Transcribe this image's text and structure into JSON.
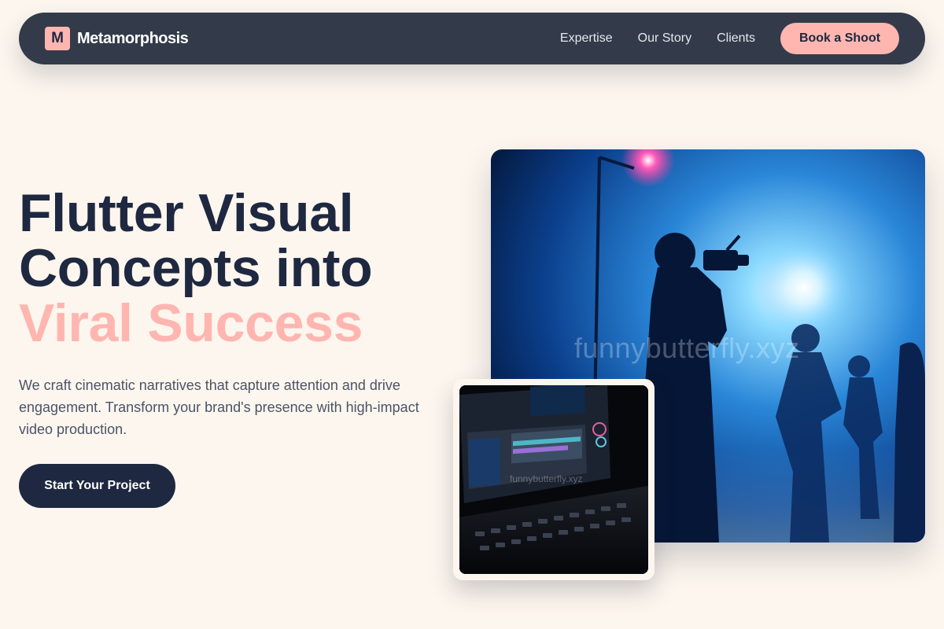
{
  "brand": {
    "logo_letter": "M",
    "name": "Metamorphosis"
  },
  "nav": {
    "links": [
      "Expertise",
      "Our Story",
      "Clients"
    ],
    "cta_label": "Book a Shoot"
  },
  "hero": {
    "title_line_1": "Flutter Visual",
    "title_line_2": "Concepts into",
    "title_accent": "Viral Success",
    "description": "We craft cinematic narratives that capture attention and drive engagement. Transform your brand's presence with high-impact video production.",
    "cta_label": "Start Your Project"
  },
  "media": {
    "main_image_watermark": "funnybutterfly.xyz",
    "secondary_image_watermark": "funnybutterfly.xyz"
  },
  "colors": {
    "background": "#fdf6ee",
    "navy": "#1e2840",
    "nav_bg": "#333b4a",
    "accent_pink": "#ffb6b0"
  }
}
